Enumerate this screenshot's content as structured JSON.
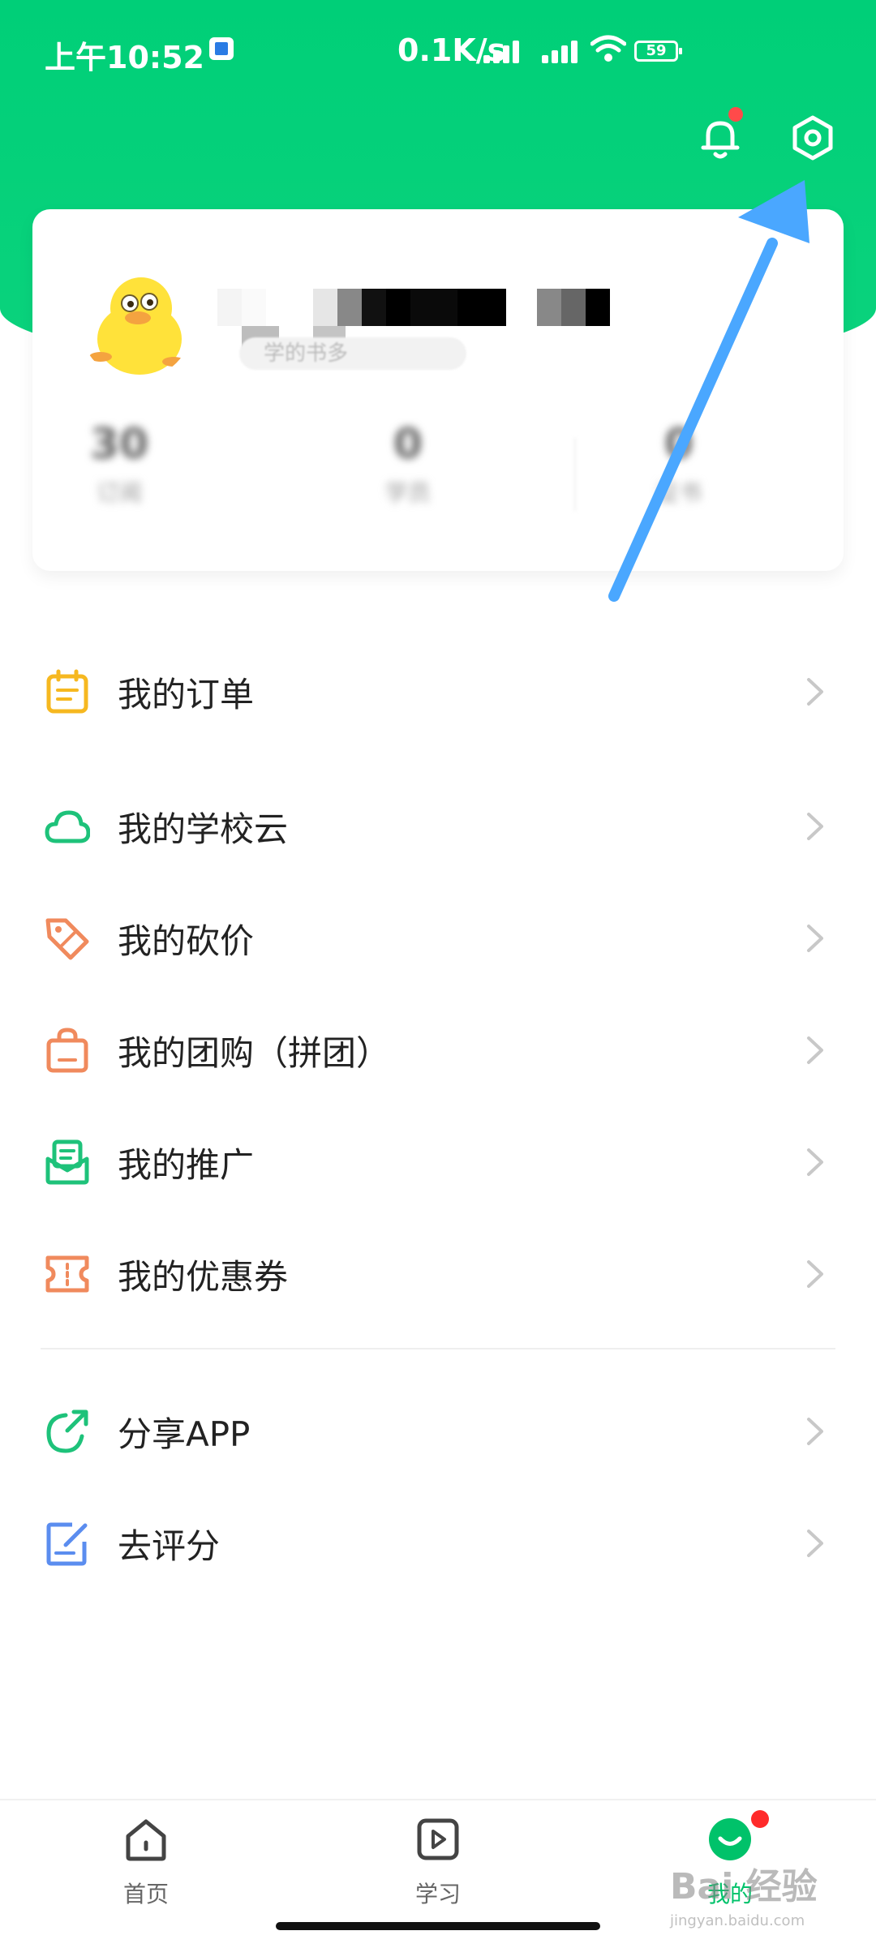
{
  "status_bar": {
    "time": "上午10:52",
    "speed": "0.1K/s",
    "battery": "59"
  },
  "colors": {
    "brand_green": "#00cf78",
    "accent_red": "#ff4a4a",
    "arrow_blue": "#4aa7ff"
  },
  "header": {
    "icons": [
      "bell-icon",
      "settings-icon"
    ]
  },
  "profile": {
    "subtitle": "学的书多",
    "stats": [
      {
        "value": "30",
        "label": "订阅"
      },
      {
        "value": "0",
        "label": "学员"
      },
      {
        "value": "0",
        "label": "证书"
      }
    ]
  },
  "menu": {
    "orders": "我的订单",
    "school_cloud": "我的学校云",
    "bargain": "我的砍价",
    "group_buy": "我的团购（拼团）",
    "promotion": "我的推广",
    "coupons": "我的优惠券",
    "share_app": "分享APP",
    "rate": "去评分"
  },
  "tabbar": {
    "home": "首页",
    "study": "学习",
    "mine": "我的"
  },
  "watermark": {
    "text": "Bai 经验",
    "sub": "jingyan.baidu.com"
  }
}
